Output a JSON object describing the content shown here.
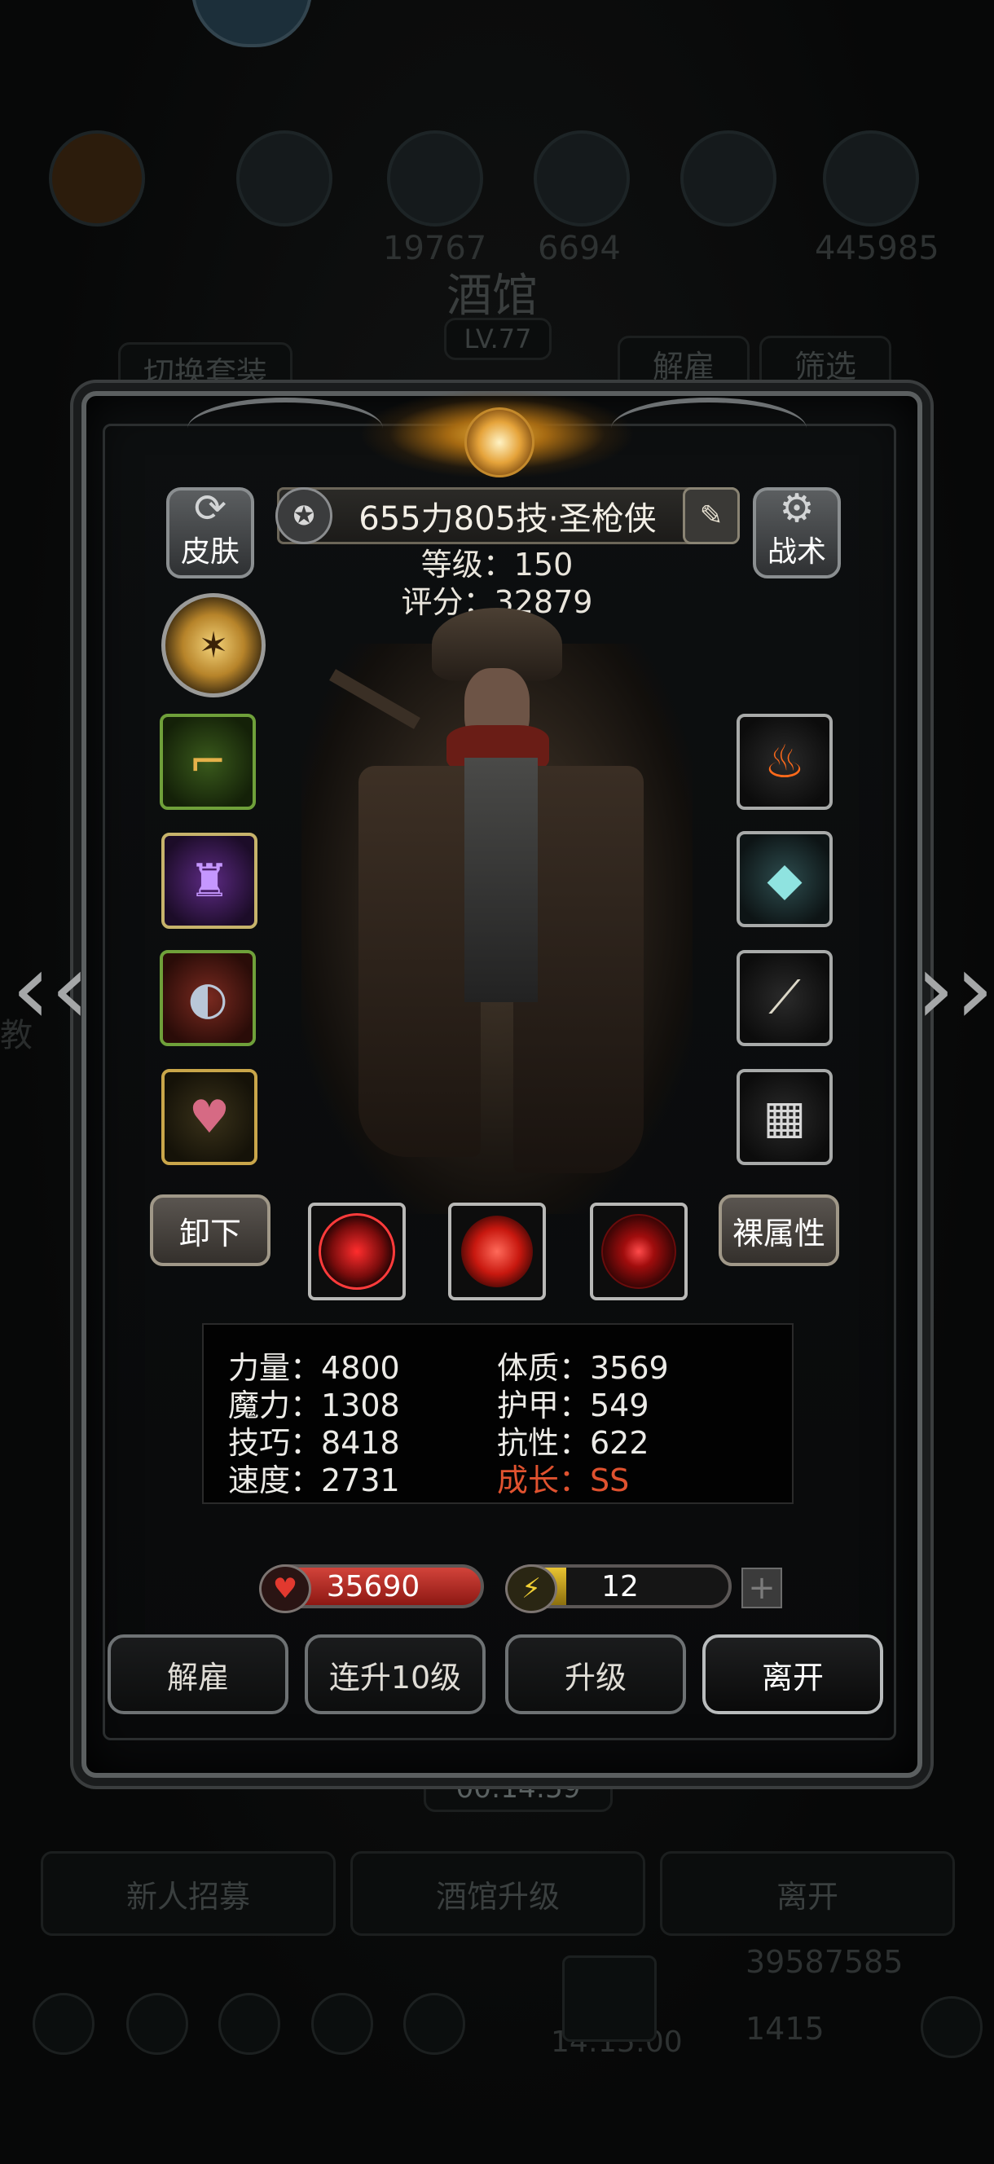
{
  "background": {
    "screen_title": "酒馆",
    "tavern_level": "LV.77",
    "switch_set_label": "切换套装",
    "dismiss_label": "解雇",
    "filter_label": "筛选",
    "stat_left": "19767",
    "stat_mid": "6694",
    "stat_right": "445985",
    "timer": "00:14:59",
    "recruit_label": "新人招募",
    "upgrade_tavern_label": "酒馆升级",
    "leave_label": "离开",
    "gold_amount": "39587585",
    "gem_amount": "1415",
    "clock": "14:15:00",
    "side_text": "教"
  },
  "hero": {
    "name": "655力805技·圣枪侠",
    "level_line": "等级：150",
    "score_line": "评分：32879",
    "skin_label": "皮肤",
    "tactics_label": "战术",
    "unequip_label": "卸下",
    "bare_attr_label": "裸属性"
  },
  "stats": {
    "strength": "力量：4800",
    "magic": "魔力：1308",
    "skill": "技巧：8418",
    "speed": "速度：2731",
    "constitution": "体质：3569",
    "armor": "护甲：549",
    "resistance": "抗性：622",
    "growth_label": "成长：",
    "growth_value": "SS"
  },
  "bars": {
    "hp": "35690",
    "energy": "12",
    "energy_fraction": 0.25,
    "plus": "+"
  },
  "actions": {
    "dismiss": "解雇",
    "upgrade10": "连升10级",
    "upgrade": "升级",
    "leave": "离开"
  },
  "icons": {
    "left_arrow": "‹‹",
    "right_arrow": "››",
    "medal": "medal-icon",
    "edit": "edit-icon",
    "skin": "refresh-icon",
    "tactics": "gear-icon"
  },
  "colors": {
    "growth": "#e0522f",
    "hp": "#d2433a",
    "energy": "#e9c431"
  }
}
